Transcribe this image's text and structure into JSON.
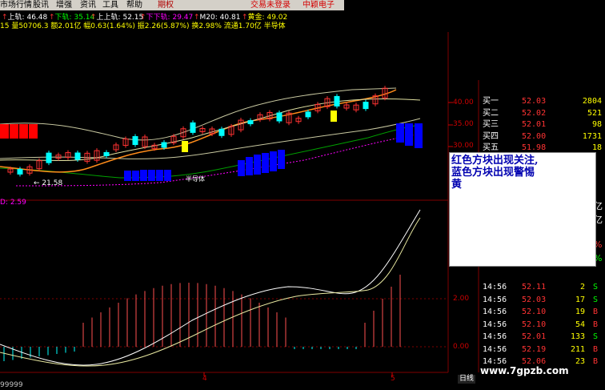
{
  "menu": {
    "items": [
      "市场行情",
      "股讯",
      "增强",
      "资讯",
      "工具",
      "帮助",
      "期权"
    ],
    "status_text": [
      "交易未登录",
      "中颖电子"
    ]
  },
  "indicator_bar": {
    "row1": [
      {
        "label": "上轨:",
        "value": "46.48",
        "color": "#ffffff"
      },
      {
        "label": "下轨:",
        "value": "35.14",
        "color": "#00ff00"
      },
      {
        "label": "上上轨:",
        "value": "52.15",
        "color": "#ffffff"
      },
      {
        "label": "下下轨:",
        "value": "29.47",
        "color": "#ff00ff"
      },
      {
        "label": "M20:",
        "value": "40.81",
        "color": "#ffffff"
      },
      {
        "label": "黄金:",
        "value": "49.02",
        "color": "#ffff00"
      }
    ],
    "row2": "15 量50706.3 额2.01亿 幅0.63(1.64%) 振2.26(5.87%) 换2.98% 流通1.70亿 半导体"
  },
  "price_axis": [
    "40.00",
    "35.00",
    "30.00"
  ],
  "macd_label": "D: 2.59",
  "macd_axis": [
    "2.00",
    "0.00"
  ],
  "low_marker": "← 21.58",
  "popup": {
    "lines": [
      "红色方块出现关注,",
      "蓝色方块出现警惕",
      "黄"
    ]
  },
  "order_book": [
    {
      "label": "买一",
      "price": "52.03",
      "vol": "2804"
    },
    {
      "label": "买二",
      "price": "52.02",
      "vol": "521"
    },
    {
      "label": "买三",
      "price": "52.01",
      "vol": "98"
    },
    {
      "label": "买四",
      "price": "52.00",
      "vol": "1731"
    },
    {
      "label": "买五",
      "price": "51.98",
      "vol": "18"
    }
  ],
  "right_partial": [
    "亿",
    "亿",
    "%",
    "%"
  ],
  "trades": [
    {
      "time": "14:56",
      "price": "52.11",
      "vol": "2",
      "side": "S"
    },
    {
      "time": "14:56",
      "price": "52.03",
      "vol": "17",
      "side": "S"
    },
    {
      "time": "14:56",
      "price": "52.10",
      "vol": "19",
      "side": "B"
    },
    {
      "time": "14:56",
      "price": "52.10",
      "vol": "54",
      "side": "B"
    },
    {
      "time": "14:56",
      "price": "52.01",
      "vol": "133",
      "side": "S"
    },
    {
      "time": "14:56",
      "price": "52.19",
      "vol": "211",
      "side": "B"
    },
    {
      "time": "14:56",
      "price": "52.06",
      "vol": "23",
      "side": "B"
    }
  ],
  "bottom": {
    "axis_labels": [
      "4",
      "5"
    ],
    "period_tab": "日线",
    "left_code": "99999"
  },
  "watermark": "www.7gpzb.com",
  "colors": {
    "up": "#ff3232",
    "down": "#00ffff",
    "alert_red": "#ff0000",
    "alert_blue": "#0000ff",
    "yellow": "#ffff00"
  }
}
